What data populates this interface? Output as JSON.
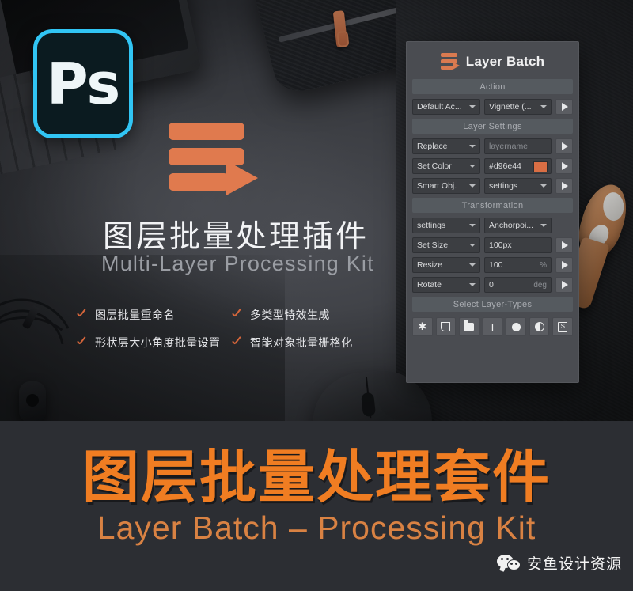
{
  "hero": {
    "ps_logo_label": "Ps",
    "title_cn": "图层批量处理插件",
    "title_en": "Multi-Layer Processing Kit",
    "brand_mark_icon": "layer-bars-play-icon",
    "features": {
      "left": [
        "图层批量重命名",
        "形状层大小角度批量设置"
      ],
      "right": [
        "多类型特效生成",
        "智能对象批量栅格化"
      ]
    }
  },
  "panel": {
    "logo_icon": "layer-bars-play-icon",
    "title": "Layer Batch",
    "sections": [
      {
        "header": "Action",
        "rows": [
          {
            "select": "Default Ac...",
            "value": "Vignette (...",
            "value_type": "select",
            "run": "run-icon"
          }
        ]
      },
      {
        "header": "Layer Settings",
        "rows": [
          {
            "select": "Replace",
            "value": "layername",
            "value_type": "placeholder",
            "run": "run-icon"
          },
          {
            "select": "Set Color",
            "value": "#d96e44",
            "value_type": "color",
            "swatch": "#d96e44",
            "run": "run-icon"
          },
          {
            "select": "Smart Obj.",
            "value": "settings",
            "value_type": "select",
            "run": "run-icon"
          }
        ]
      },
      {
        "header": "Transformation",
        "rows": [
          {
            "select": "settings",
            "value": "Anchorpoi...",
            "value_type": "select",
            "run": null
          },
          {
            "select": "Set Size",
            "value": "100px",
            "value_type": "text",
            "run": "run-icon"
          },
          {
            "select": "Resize",
            "value": "100",
            "unit": "%",
            "value_type": "text",
            "run": "run-icon"
          },
          {
            "select": "Rotate",
            "value": "0",
            "unit": "deg",
            "value_type": "text",
            "run": "run-icon"
          }
        ]
      }
    ],
    "layer_types_header": "Select Layer-Types",
    "layer_types": [
      {
        "name": "all-layers",
        "glyph": "✱"
      },
      {
        "name": "pixel-layer",
        "glyph": ""
      },
      {
        "name": "group-folder",
        "glyph": ""
      },
      {
        "name": "text-layer",
        "glyph": "T"
      },
      {
        "name": "shape-layer",
        "glyph": ""
      },
      {
        "name": "adjustment-layer",
        "glyph": ""
      },
      {
        "name": "smart-object",
        "glyph": "S"
      }
    ]
  },
  "banner": {
    "title": "图层批量处理套件",
    "subtitle": "Layer Batch – Processing Kit",
    "accent_color": "#f07d22",
    "subtitle_color": "#d98243"
  },
  "watermark": {
    "icon": "wechat-icon",
    "text": "安鱼设计资源"
  }
}
